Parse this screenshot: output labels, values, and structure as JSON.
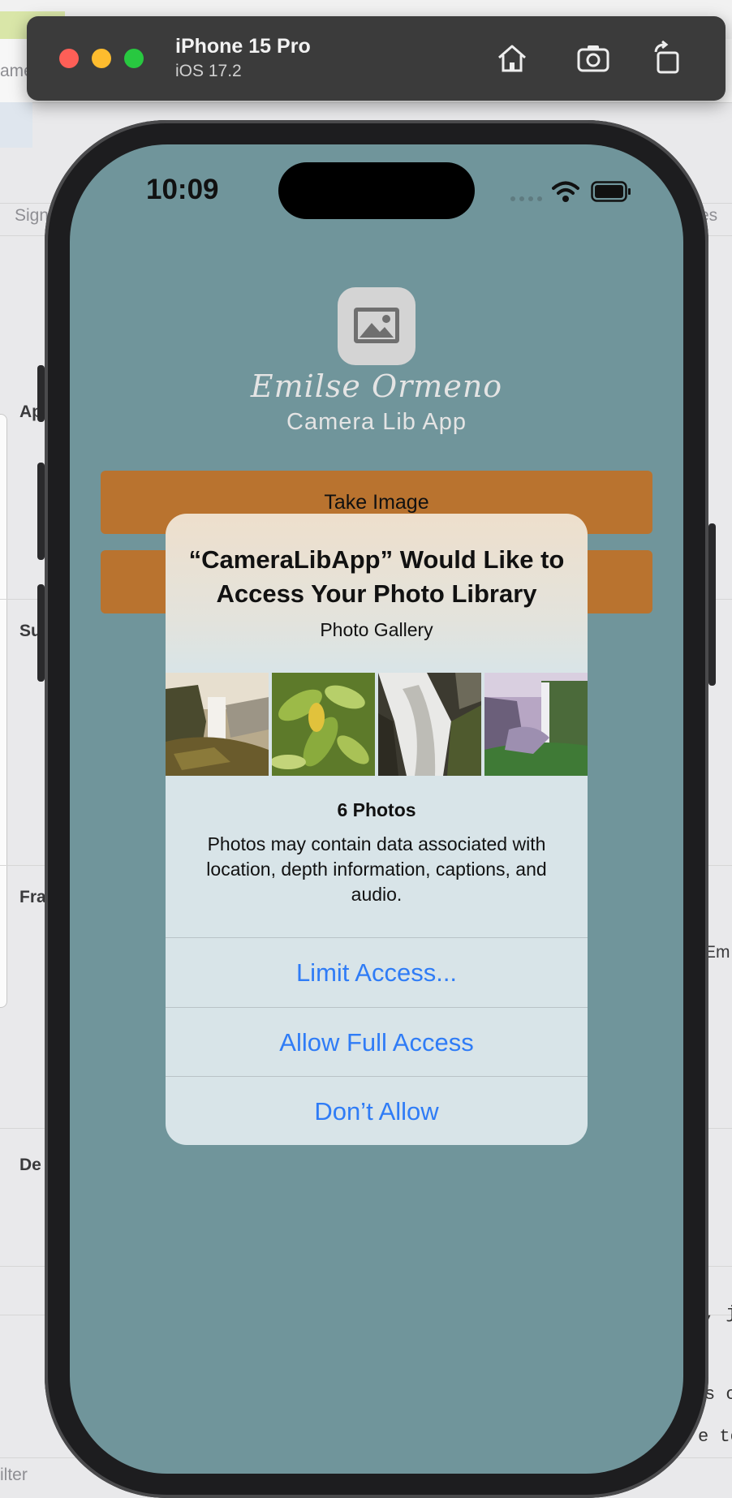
{
  "background": {
    "left_fragments": [
      "ame",
      "Sign",
      "Ap",
      "Su",
      "Fra",
      "De",
      "ilter"
    ],
    "right_fragments": [
      "es",
      "Em"
    ],
    "code_fragments": [
      ", j",
      "s c",
      "e to"
    ]
  },
  "simulator": {
    "device_name": "iPhone 15 Pro",
    "os_version": "iOS 17.2",
    "home_icon": "home-icon",
    "screenshot_icon": "camera-icon",
    "rotate_icon": "rotate-icon"
  },
  "status_bar": {
    "time": "10:09",
    "icons": [
      "cellular-icon",
      "wifi-icon",
      "battery-icon"
    ]
  },
  "app": {
    "logo_icon": "image-placeholder-icon",
    "title": "Emilse Ormeno",
    "subtitle": "Camera Lib App",
    "take_image_label": "Take Image",
    "second_button_label": ""
  },
  "alert": {
    "title": "“CameraLibApp” Would Like to Access Your Photo Library",
    "subtitle": "Photo Gallery",
    "photo_count": "6 Photos",
    "message": "Photos may contain data associated with location, depth information, captions, and audio.",
    "buttons": [
      "Limit Access...",
      "Allow Full Access",
      "Don’t Allow"
    ]
  },
  "colors": {
    "screen_bg": "#70959b",
    "button_orange": "#b9732f",
    "alert_button_text": "#2f7cf6"
  }
}
